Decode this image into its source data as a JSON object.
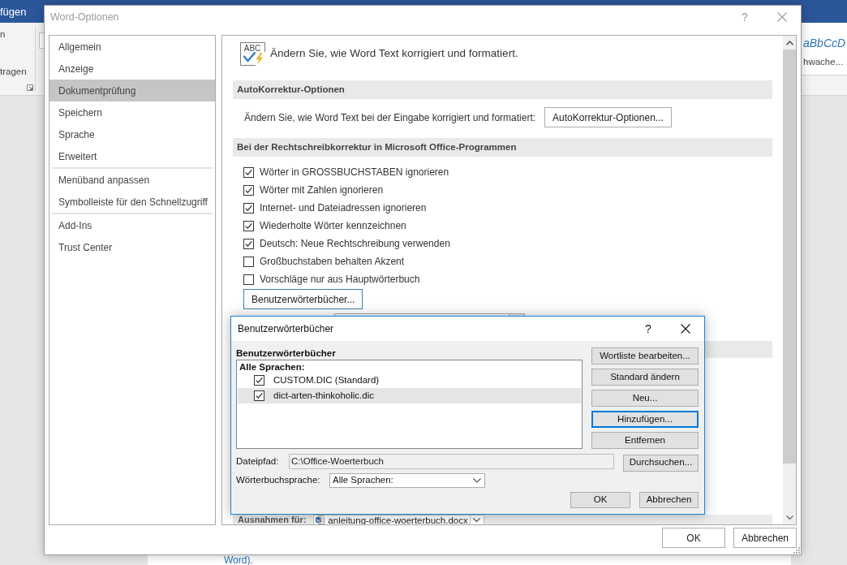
{
  "word_window": {
    "tab": "fügen",
    "ribbon_labels": [
      "n",
      "tragen"
    ],
    "style_preview": "aBbCcD",
    "style_name": "hwache...",
    "document_text": "Word)."
  },
  "options_dialog": {
    "title": "Word-Optionen",
    "help": "?",
    "sidebar": {
      "groups": [
        {
          "items": [
            {
              "label": "Allgemein",
              "selected": false
            },
            {
              "label": "Anzeige",
              "selected": false
            },
            {
              "label": "Dokumentprüfung",
              "selected": true
            },
            {
              "label": "Speichern",
              "selected": false
            },
            {
              "label": "Sprache",
              "selected": false
            },
            {
              "label": "Erweitert",
              "selected": false
            }
          ]
        },
        {
          "items": [
            {
              "label": "Menüband anpassen",
              "selected": false
            },
            {
              "label": "Symbolleiste für den Schnellzugriff",
              "selected": false
            }
          ]
        },
        {
          "items": [
            {
              "label": "Add-Ins",
              "selected": false
            },
            {
              "label": "Trust Center",
              "selected": false
            }
          ]
        }
      ]
    },
    "content": {
      "icon_text": "ABC",
      "heading": "Ändern Sie, wie Word Text korrigiert und formatiert.",
      "sections": [
        {
          "title": "AutoKorrektur-Optionen",
          "rows": [
            {
              "kind": "button_row",
              "label": "Ändern Sie, wie Word Text bei der Eingabe korrigiert und formatiert:",
              "button": "AutoKorrektur-Optionen...",
              "focused": false
            }
          ]
        },
        {
          "title": "Bei der Rechtschreibkorrektur in Microsoft Office-Programmen",
          "rows": [
            {
              "kind": "checkbox",
              "label": "Wörter in GROSSBUCHSTABEN ignorieren",
              "checked": true
            },
            {
              "kind": "checkbox",
              "label": "Wörter mit Zahlen ignorieren",
              "checked": true
            },
            {
              "kind": "checkbox",
              "label": "Internet- und Dateiadressen ignorieren",
              "checked": true
            },
            {
              "kind": "checkbox",
              "label": "Wiederholte Wörter kennzeichnen",
              "checked": true
            },
            {
              "kind": "checkbox",
              "label": "Deutsch: Neue Rechtschreibung verwenden",
              "checked": true
            },
            {
              "kind": "checkbox",
              "label": "Großbuchstaben behalten Akzent",
              "checked": false
            },
            {
              "kind": "checkbox",
              "label": "Vorschläge nur aus Hauptwörterbuch",
              "checked": false
            },
            {
              "kind": "button",
              "label": "Benutzerwörterbücher...",
              "focused": true
            }
          ]
        }
      ],
      "exceptions": {
        "label": "Ausnahmen für:",
        "document": "anleitung-office-woerterbuch.docx"
      }
    },
    "buttons": [
      "OK",
      "Abbrechen"
    ]
  },
  "dictionaries_dialog": {
    "title": "Benutzerwörterbücher",
    "help": "?",
    "list_label": "Benutzerwörterbücher",
    "list": {
      "group": "Alle Sprachen:",
      "items": [
        {
          "label": "CUSTOM.DIC (Standard)",
          "checked": true,
          "selected": false
        },
        {
          "label": "dict-arten-thinkoholic.dic",
          "checked": true,
          "selected": true
        }
      ]
    },
    "side_buttons": [
      {
        "label": "Wortliste bearbeiten...",
        "focused": false
      },
      {
        "label": "Standard ändern",
        "focused": false
      },
      {
        "label": "Neu...",
        "focused": false
      },
      {
        "label": "Hinzufügen...",
        "focused": true
      },
      {
        "label": "Entfernen",
        "focused": false
      }
    ],
    "path": {
      "label": "Dateipfad:",
      "value": "C:\\Office-Woerterbuch",
      "button": "Durchsuchen..."
    },
    "language": {
      "label": "Wörterbuchsprache:",
      "value": "Alle Sprachen:"
    },
    "buttons": [
      "OK",
      "Abbrechen"
    ]
  }
}
